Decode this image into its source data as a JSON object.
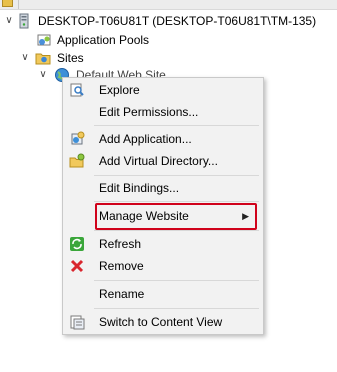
{
  "tree": {
    "server": {
      "label": "DESKTOP-T06U81T (DESKTOP-T06U81T\\TM-135)",
      "icon": "server-icon"
    },
    "app_pools": {
      "label": "Application Pools",
      "icon": "app-pools-icon"
    },
    "sites": {
      "label": "Sites",
      "icon": "sites-folder-icon"
    },
    "default_site": {
      "label": "Default Web Site",
      "icon": "globe-icon"
    }
  },
  "context_menu": {
    "items": [
      {
        "label": "Explore",
        "icon": "explore-icon"
      },
      {
        "label": "Edit Permissions..."
      },
      {
        "label": "Add Application...",
        "icon": "add-application-icon"
      },
      {
        "label": "Add Virtual Directory...",
        "icon": "add-virtual-directory-icon"
      },
      {
        "label": "Edit Bindings..."
      },
      {
        "label": "Manage Website",
        "has_submenu": true
      },
      {
        "label": "Refresh",
        "icon": "refresh-icon"
      },
      {
        "label": "Remove",
        "icon": "remove-icon"
      },
      {
        "label": "Rename"
      },
      {
        "label": "Switch to Content View",
        "icon": "content-view-icon"
      }
    ]
  },
  "colors": {
    "highlight_border": "#d0021b",
    "menu_background": "#f2f2f2"
  }
}
